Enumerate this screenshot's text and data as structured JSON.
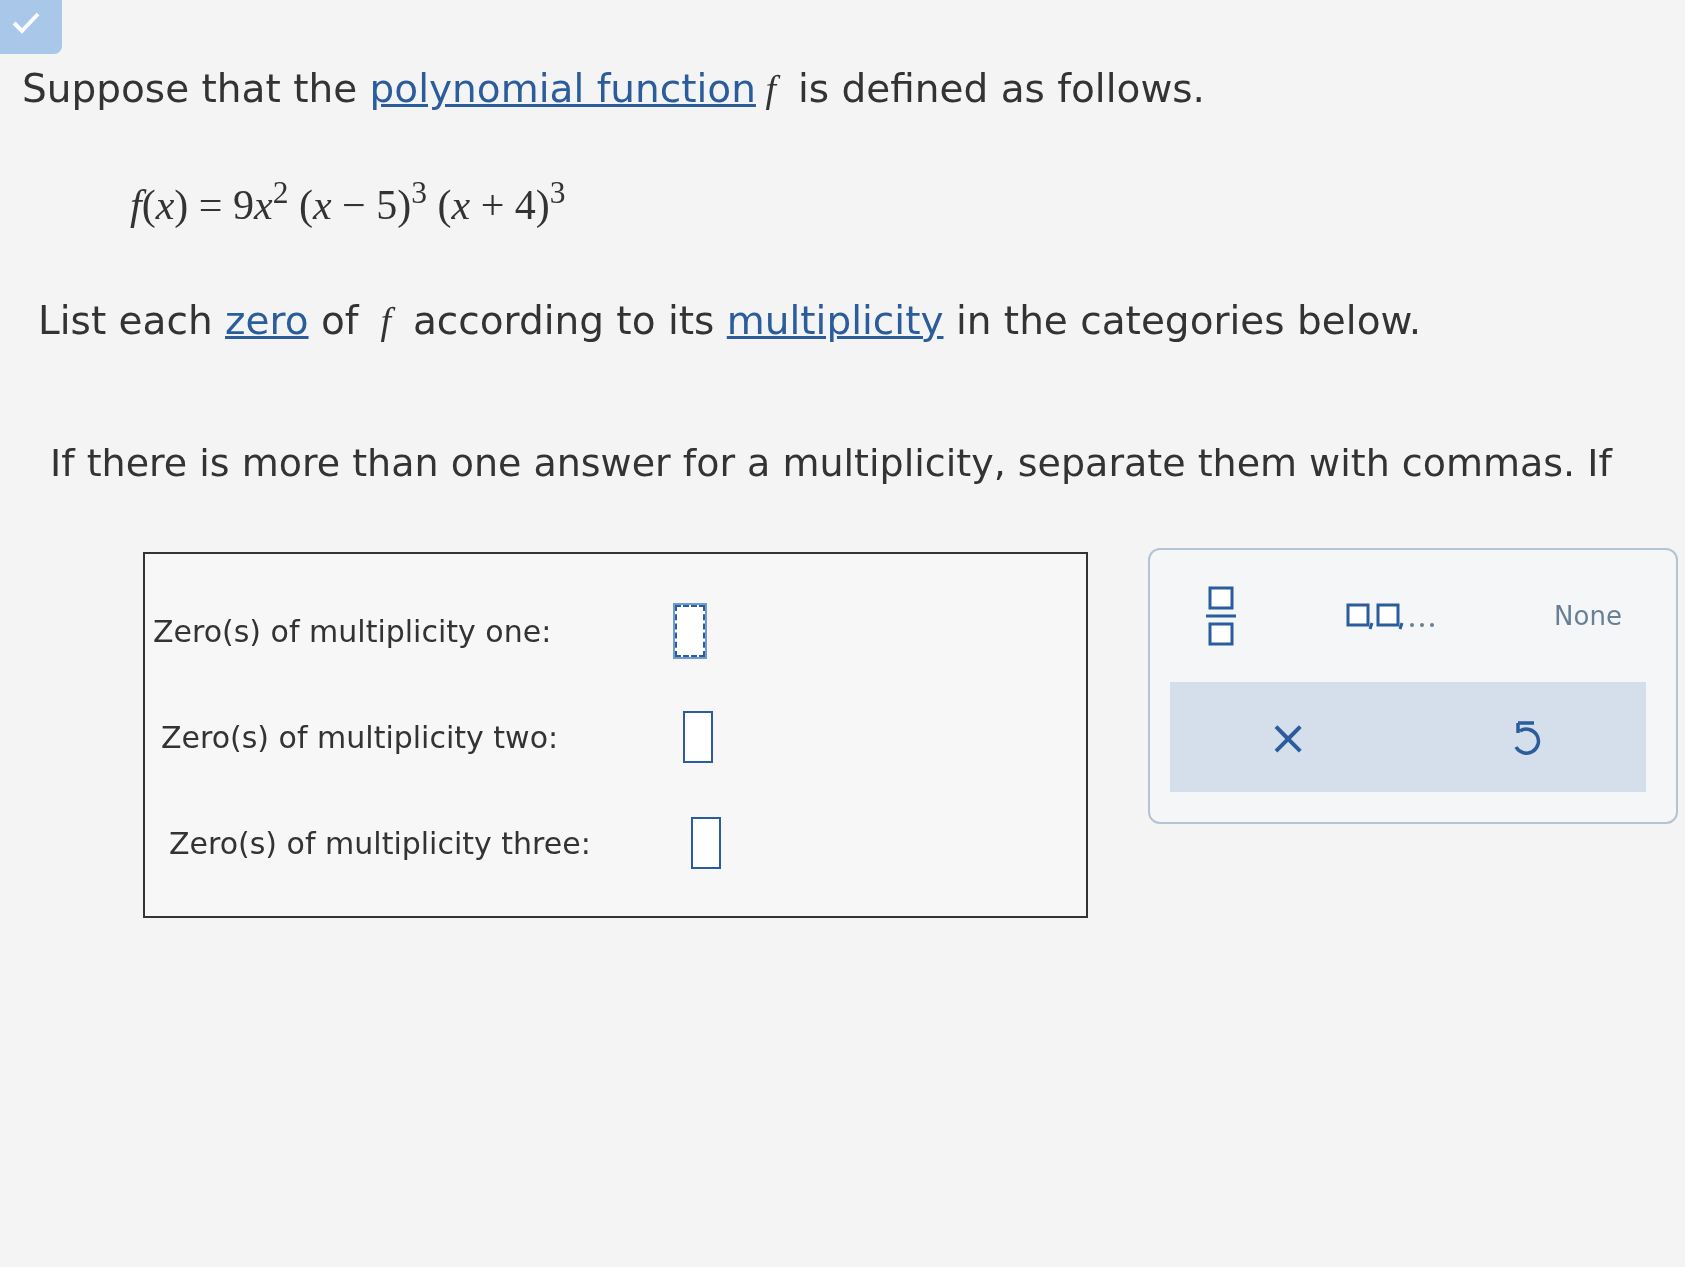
{
  "badge": {
    "checked": true
  },
  "intro": [
    {
      "kind": "text",
      "text": "Suppose that the "
    },
    {
      "kind": "link",
      "text": "polynomial function"
    },
    {
      "kind": "math",
      "text": "f"
    },
    {
      "kind": "text",
      "text": " is defined as follows."
    }
  ],
  "equation": [
    {
      "kind": "math",
      "text": "f"
    },
    {
      "kind": "text",
      "text": "("
    },
    {
      "kind": "math",
      "text": "x"
    },
    {
      "kind": "text",
      "text": ") = 9"
    },
    {
      "kind": "math",
      "text": "x"
    },
    {
      "kind": "sup",
      "text": "2"
    },
    {
      "kind": "text",
      "text": " ("
    },
    {
      "kind": "math",
      "text": "x"
    },
    {
      "kind": "text",
      "text": " − 5)"
    },
    {
      "kind": "sup",
      "text": "3"
    },
    {
      "kind": "text",
      "text": " ("
    },
    {
      "kind": "math",
      "text": "x"
    },
    {
      "kind": "text",
      "text": " + 4)"
    },
    {
      "kind": "sup",
      "text": "3"
    }
  ],
  "instruction": [
    {
      "kind": "text",
      "text": "List each "
    },
    {
      "kind": "link",
      "text": "zero"
    },
    {
      "kind": "text",
      "text": " of "
    },
    {
      "kind": "math",
      "text": "f"
    },
    {
      "kind": "text",
      "text": " according to its "
    },
    {
      "kind": "link",
      "text": "multiplicity"
    },
    {
      "kind": "text",
      "text": " in the categories below."
    }
  ],
  "note": "If there is more than one answer for a multiplicity, separate them with commas. If",
  "answers": [
    {
      "label": "Zero(s) of multiplicity one:",
      "focused": true
    },
    {
      "label": "Zero(s) of multiplicity two:",
      "focused": false
    },
    {
      "label": "Zero(s) of multiplicity three:",
      "focused": false
    }
  ],
  "palette": {
    "none": "None",
    "clear": "×"
  }
}
